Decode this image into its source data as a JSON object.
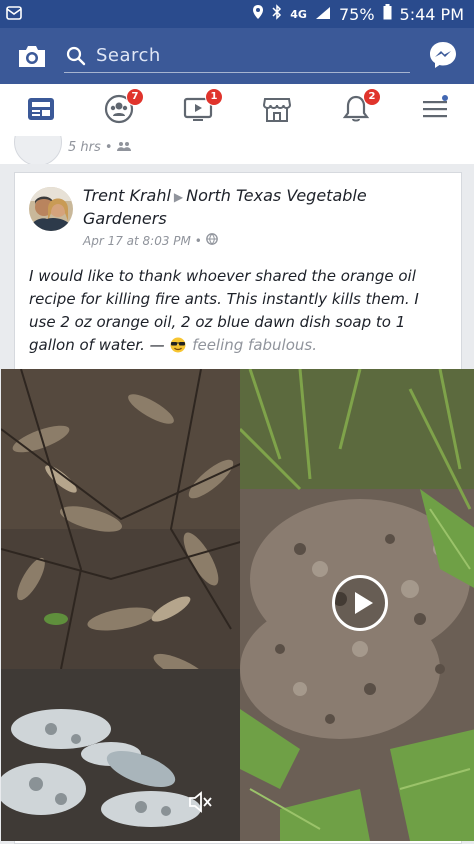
{
  "status_bar": {
    "signal_label": "4G",
    "battery": "75%",
    "time": "5:44 PM"
  },
  "app_bar": {
    "search_placeholder": "Search"
  },
  "nav": {
    "tabs": [
      {
        "name": "news-feed",
        "badge": ""
      },
      {
        "name": "groups",
        "badge": "7"
      },
      {
        "name": "watch",
        "badge": "1"
      },
      {
        "name": "marketplace",
        "badge": ""
      },
      {
        "name": "notifications",
        "badge": "2"
      },
      {
        "name": "menu",
        "badge": ""
      }
    ]
  },
  "previous_post": {
    "time": "5 hrs •"
  },
  "post": {
    "author": "Trent Krahl",
    "group": "North Texas Vegetable Gardeners",
    "timestamp": "Apr 17 at 8:03 PM •",
    "body": "I would like to thank whoever shared the orange oil recipe for killing fire ants. This instantly kills them. I use 2 oz orange oil, 2 oz blue dawn dish soap to 1 gallon of water. —",
    "feeling": "feeling fabulous."
  },
  "colors": {
    "facebook_blue": "#3b5998",
    "status_blue": "#2a4b8d",
    "badge_red": "#e0342c"
  }
}
